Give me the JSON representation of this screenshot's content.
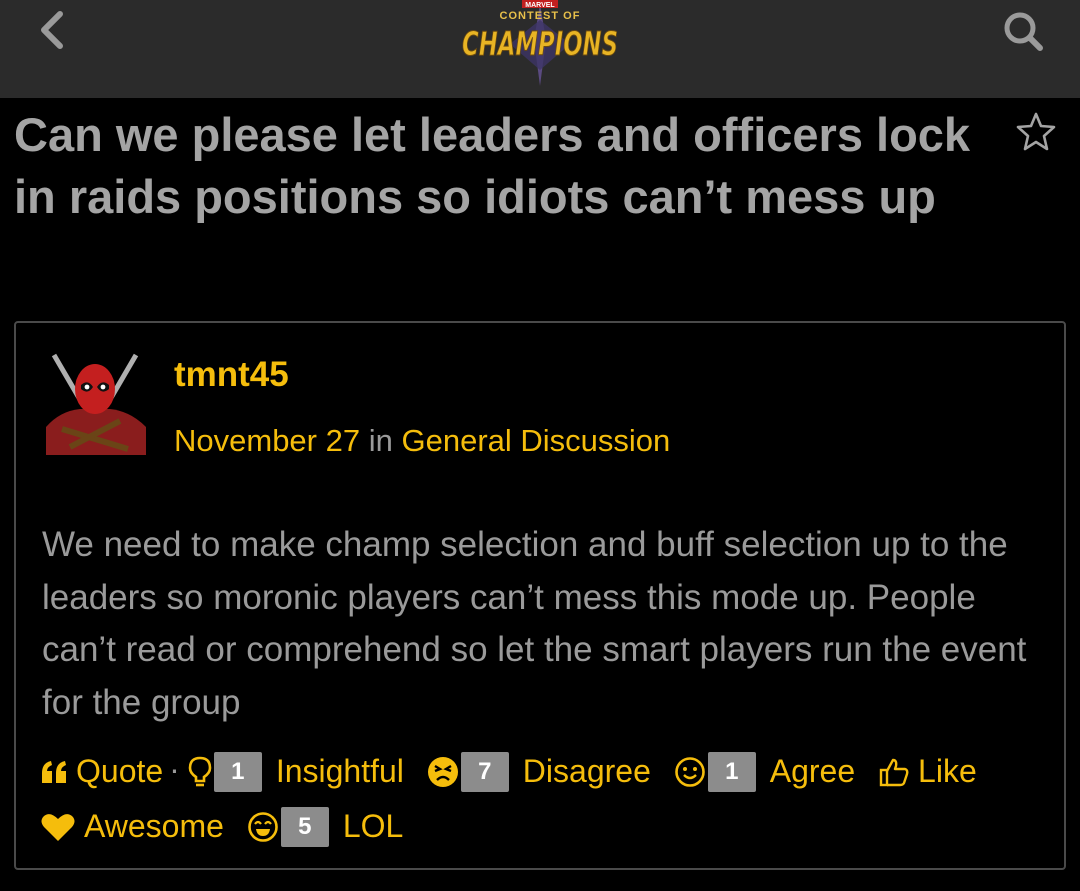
{
  "header": {
    "logo_brand": "MARVEL",
    "logo_line1": "CONTEST OF",
    "logo_line2": "CHAMPIONS"
  },
  "thread": {
    "title": "Can we please let leaders and officers lock in raids positions so idiots can’t mess up"
  },
  "post": {
    "author": "tmnt45",
    "date": "November 27",
    "in_word": "in",
    "category": "General Discussion",
    "body": "We need to make champ selection and buff selection up to the leaders so moronic players can’t mess this mode up. People can’t read or comprehend so let the smart players run the event for the group"
  },
  "reactions": {
    "quote": "Quote",
    "separator": "·",
    "insightful": {
      "count": "1",
      "label": "Insightful"
    },
    "disagree": {
      "count": "7",
      "label": "Disagree"
    },
    "agree": {
      "count": "1",
      "label": "Agree"
    },
    "like": {
      "label": "Like"
    },
    "awesome": {
      "label": "Awesome"
    },
    "lol": {
      "count": "5",
      "label": "LOL"
    }
  },
  "colors": {
    "accent": "#f5bd0c",
    "background": "#000000",
    "header_bg": "#2b2b2b",
    "text": "#9a9a9a",
    "count_badge": "#8c8c8c"
  },
  "icons": [
    "back-chevron-icon",
    "search-icon",
    "bookmark-star-icon",
    "quote-icon",
    "lightbulb-icon",
    "disagree-face-icon",
    "smile-face-icon",
    "thumbs-up-icon",
    "heart-icon",
    "laugh-face-icon"
  ]
}
